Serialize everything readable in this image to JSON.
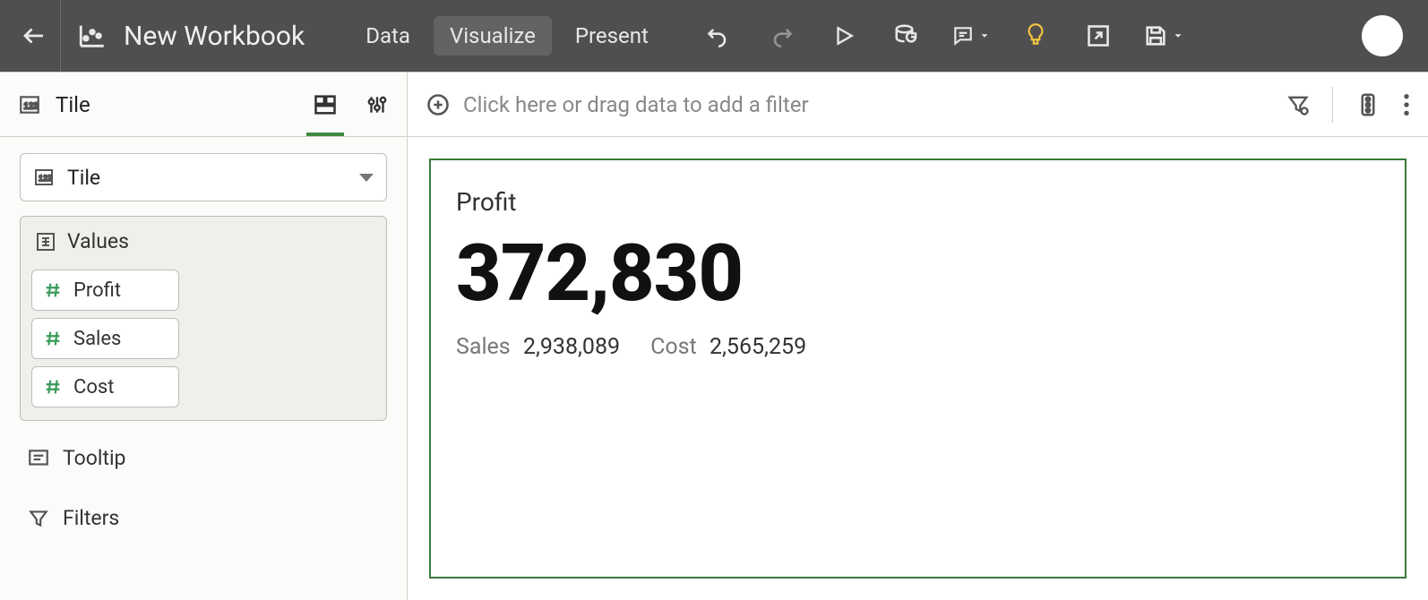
{
  "header": {
    "title": "New Workbook",
    "tabs": [
      "Data",
      "Visualize",
      "Present"
    ],
    "active_tab": 1
  },
  "side": {
    "title": "Tile",
    "viz_type_label": "Tile",
    "values_label": "Values",
    "measures": [
      "Profit",
      "Sales",
      "Cost"
    ],
    "tooltip_label": "Tooltip",
    "filters_label": "Filters"
  },
  "filter_bar": {
    "placeholder": "Click here or drag data to add a filter"
  },
  "tile": {
    "title": "Profit",
    "value": "372,830",
    "secondary": [
      {
        "label": "Sales",
        "value": "2,938,089"
      },
      {
        "label": "Cost",
        "value": "2,565,259"
      }
    ]
  }
}
